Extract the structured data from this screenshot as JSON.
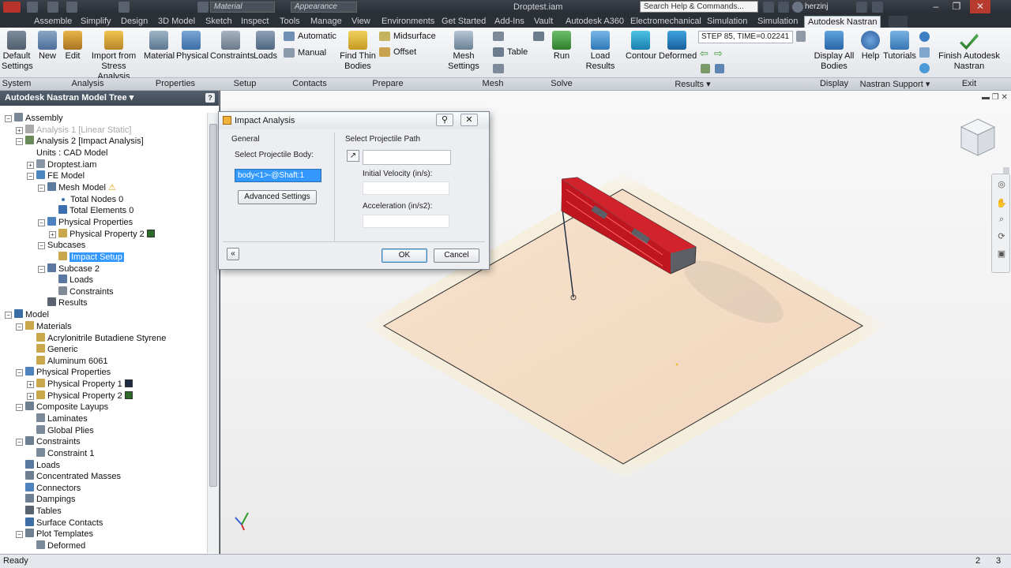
{
  "titlebar": {
    "material_combo": "Material",
    "appearance_combo": "Appearance",
    "document_title": "Droptest.iam",
    "search_placeholder": "Search Help & Commands...",
    "user_name": "herzinj",
    "help_label": "?"
  },
  "ribbon_tabs": [
    {
      "label": "Assemble"
    },
    {
      "label": "Simplify"
    },
    {
      "label": "Design"
    },
    {
      "label": "3D Model"
    },
    {
      "label": "Sketch"
    },
    {
      "label": "Inspect"
    },
    {
      "label": "Tools"
    },
    {
      "label": "Manage"
    },
    {
      "label": "View"
    },
    {
      "label": "Environments"
    },
    {
      "label": "Get Started"
    },
    {
      "label": "Add-Ins"
    },
    {
      "label": "Vault"
    },
    {
      "label": "Autodesk A360"
    },
    {
      "label": "Electromechanical"
    },
    {
      "label": "Simulation"
    },
    {
      "label": "Simulation"
    },
    {
      "label": "Autodesk Nastran"
    }
  ],
  "ribbon": {
    "default_settings": "Default Settings",
    "new": "New",
    "edit": "Edit",
    "import_stress": "Import from Stress Analysis",
    "material": "Material",
    "physical": "Physical",
    "constraints": "Constraints",
    "loads": "Loads",
    "automatic": "Automatic",
    "manual": "Manual",
    "find_thin_bodies": "Find Thin Bodies",
    "midsurface": "Midsurface",
    "offset": "Offset",
    "mesh_settings": "Mesh Settings",
    "table": "Table",
    "run": "Run",
    "load_results": "Load Results",
    "contour": "Contour",
    "deformed": "Deformed",
    "step_combo": "STEP 85, TIME=0.02241",
    "display_all_bodies": "Display All Bodies",
    "help": "Help",
    "tutorials": "Tutorials",
    "finish_nastran": "Finish Autodesk Nastran"
  },
  "panels": {
    "system": "System",
    "analysis": "Analysis",
    "properties": "Properties",
    "setup": "Setup",
    "contacts": "Contacts",
    "prepare": "Prepare",
    "mesh": "Mesh",
    "solve": "Solve",
    "results": "Results",
    "display": "Display",
    "nastran_support": "Nastran Support",
    "exit": "Exit"
  },
  "browser": {
    "title": "Autodesk Nastran Model Tree",
    "help_btn": "?",
    "nodes": [
      {
        "label": "Assembly"
      },
      {
        "label": "Analysis 1 [Linear Static]"
      },
      {
        "label": "Analysis 2 [Impact Analysis]"
      },
      {
        "label": "Units : CAD Model"
      },
      {
        "label": "Droptest.iam"
      },
      {
        "label": "FE Model"
      },
      {
        "label": "Mesh Model"
      },
      {
        "label": "Total Nodes 0"
      },
      {
        "label": "Total Elements 0"
      },
      {
        "label": "Physical Properties"
      },
      {
        "label": "Physical Property 2"
      },
      {
        "label": "Subcases"
      },
      {
        "label": "Impact Setup"
      },
      {
        "label": "Subcase 2"
      },
      {
        "label": "Loads"
      },
      {
        "label": "Constraints"
      },
      {
        "label": "Results"
      },
      {
        "label": "Model"
      },
      {
        "label": "Materials"
      },
      {
        "label": "Acrylonitrile Butadiene Styrene"
      },
      {
        "label": "Generic"
      },
      {
        "label": "Aluminum 6061"
      },
      {
        "label": "Physical Properties"
      },
      {
        "label": "Physical Property 1"
      },
      {
        "label": "Physical Property 2"
      },
      {
        "label": "Composite Layups"
      },
      {
        "label": "Laminates"
      },
      {
        "label": "Global Plies"
      },
      {
        "label": "Constraints"
      },
      {
        "label": "Constraint 1"
      },
      {
        "label": "Loads"
      },
      {
        "label": "Concentrated Masses"
      },
      {
        "label": "Connectors"
      },
      {
        "label": "Dampings"
      },
      {
        "label": "Tables"
      },
      {
        "label": "Surface Contacts"
      },
      {
        "label": "Plot Templates"
      },
      {
        "label": "Deformed"
      }
    ]
  },
  "dialog": {
    "title": "Impact Analysis",
    "general_label": "General",
    "select_body_label": "Select Projectile Body:",
    "selected_body": "body<1>-@Shaft:1",
    "advanced_settings": "Advanced Settings",
    "path_label": "Select Projectile Path",
    "path_value": "",
    "velocity_label": "Initial Velocity (in/s):",
    "velocity_value": "",
    "acceleration_label": "Acceleration (in/s2):",
    "acceleration_value": "",
    "ok": "OK",
    "cancel": "Cancel",
    "expand": "«",
    "pin": "⚲",
    "close": "✕"
  },
  "statusbar": {
    "status": "Ready",
    "count_a": "2",
    "count_b": "3"
  },
  "colors": {
    "accent_blue": "#3399ff",
    "part_red": "#d8202a",
    "plate_fill": "#f5dcc4",
    "property_1": "#1f2a44",
    "property_2": "#2e6b2b"
  }
}
